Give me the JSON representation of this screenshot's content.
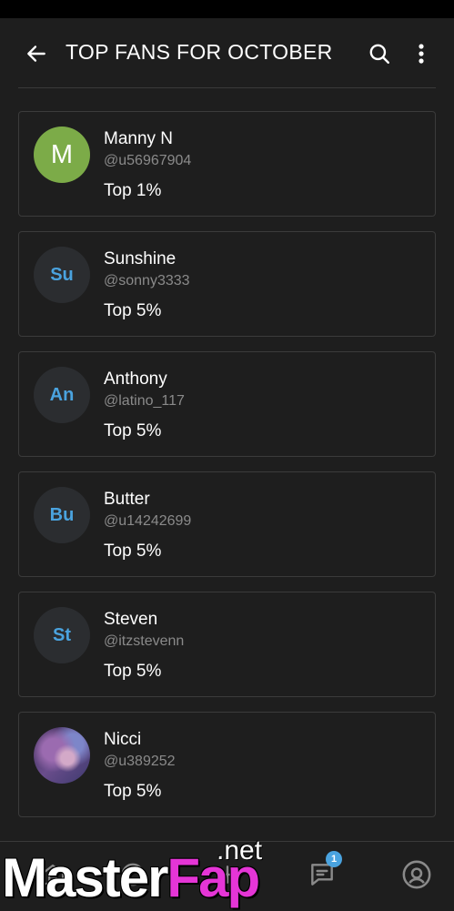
{
  "header": {
    "title": "TOP FANS FOR OCTOBER",
    "back_icon": "arrow-left-icon",
    "search_icon": "search-icon",
    "more_icon": "more-vertical-icon"
  },
  "fans": [
    {
      "name": "Manny N",
      "handle": "@u56967904",
      "rank": "Top 1%",
      "initials": "M",
      "avatar_type": "letter",
      "avatar_color": "#7cab48"
    },
    {
      "name": "Sunshine",
      "handle": "@sonny3333",
      "rank": "Top 5%",
      "initials": "Su",
      "avatar_type": "initials"
    },
    {
      "name": "Anthony",
      "handle": "@latino_117",
      "rank": "Top 5%",
      "initials": "An",
      "avatar_type": "initials"
    },
    {
      "name": "Butter",
      "handle": "@u14242699",
      "rank": "Top 5%",
      "initials": "Bu",
      "avatar_type": "initials"
    },
    {
      "name": "Steven",
      "handle": "@itzstevenn",
      "rank": "Top 5%",
      "initials": "St",
      "avatar_type": "initials"
    },
    {
      "name": "Nicci",
      "handle": "@u389252",
      "rank": "Top 5%",
      "initials": "",
      "avatar_type": "photo"
    }
  ],
  "bottom_nav": {
    "messages_badge": "1",
    "items": [
      "home-icon",
      "notifications-icon",
      "add-post-icon",
      "messages-icon",
      "profile-icon"
    ]
  },
  "watermark": {
    "main_a": "Master",
    "main_b": "Fap",
    "suffix": ".net"
  },
  "colors": {
    "background": "#1e1e1e",
    "accent": "#4aa3df",
    "card_border": "#3b3b3b",
    "handle_text": "#8a8a8a"
  }
}
